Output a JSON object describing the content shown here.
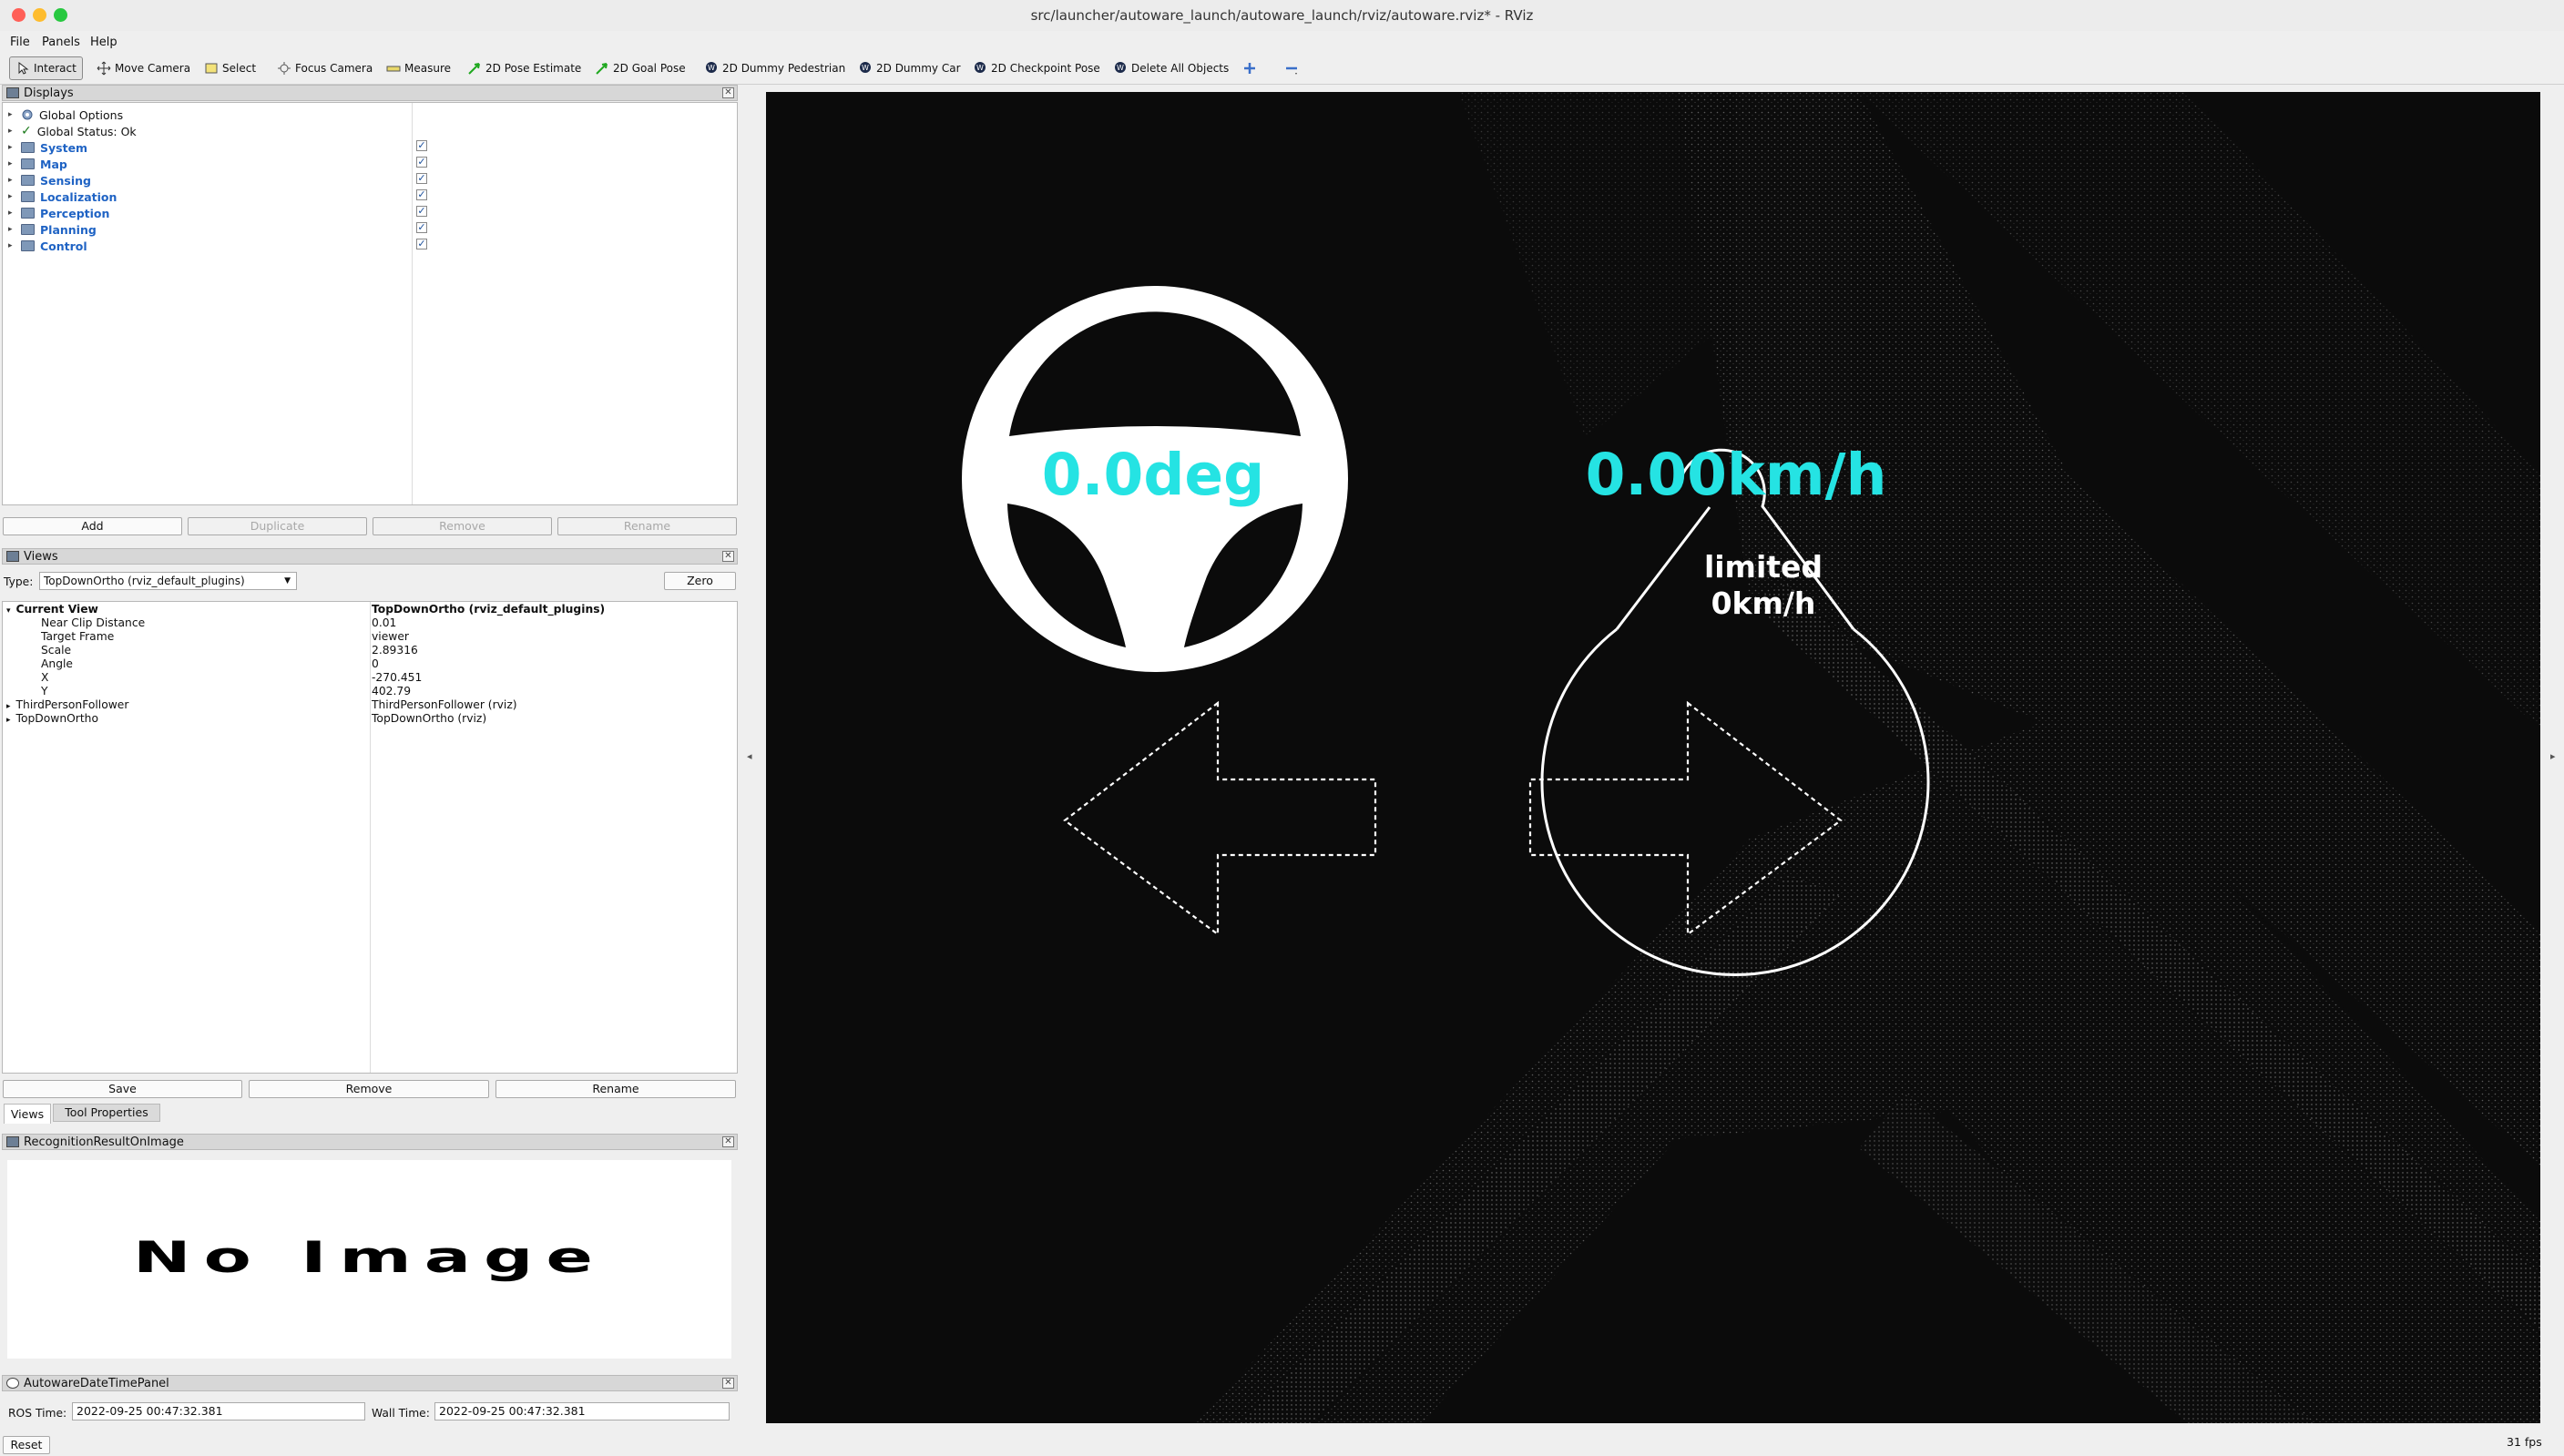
{
  "window": {
    "title": "src/launcher/autoware_launch/autoware_launch/rviz/autoware.rviz* - RViz",
    "traffic_lights": [
      "#ff5f57",
      "#febc2e",
      "#28c840"
    ]
  },
  "menu": [
    "File",
    "Panels",
    "Help"
  ],
  "toolbar": {
    "interact": "Interact",
    "move_camera": "Move Camera",
    "select": "Select",
    "focus_camera": "Focus Camera",
    "measure": "Measure",
    "pose_estimate": "2D Pose Estimate",
    "goal_pose": "2D Goal Pose",
    "dummy_pedestrian": "2D Dummy Pedestrian",
    "dummy_car": "2D Dummy Car",
    "checkpoint_pose": "2D Checkpoint Pose",
    "delete_all": "Delete All Objects"
  },
  "displays": {
    "header": "Displays",
    "global_options": "Global Options",
    "global_status": "Global Status: Ok",
    "groups": [
      "System",
      "Map",
      "Sensing",
      "Localization",
      "Perception",
      "Planning",
      "Control"
    ],
    "buttons": {
      "add": "Add",
      "duplicate": "Duplicate",
      "remove": "Remove",
      "rename": "Rename"
    }
  },
  "views": {
    "header": "Views",
    "type_label": "Type:",
    "type_value": "TopDownOrtho (rviz_default_plugins)",
    "zero": "Zero",
    "current_view": {
      "label": "Current View",
      "value": "TopDownOrtho (rviz_default_plugins)"
    },
    "props": [
      {
        "k": "Near Clip Distance",
        "v": "0.01"
      },
      {
        "k": "Target Frame",
        "v": "viewer"
      },
      {
        "k": "Scale",
        "v": "2.89316"
      },
      {
        "k": "Angle",
        "v": "0"
      },
      {
        "k": "X",
        "v": "-270.451"
      },
      {
        "k": "Y",
        "v": "402.79"
      }
    ],
    "saved": [
      {
        "k": "ThirdPersonFollower",
        "v": "ThirdPersonFollower (rviz)"
      },
      {
        "k": "TopDownOrtho",
        "v": "TopDownOrtho (rviz)"
      }
    ],
    "buttons": {
      "save": "Save",
      "remove": "Remove",
      "rename": "Rename"
    },
    "tabs": [
      "Views",
      "Tool Properties"
    ]
  },
  "recognition": {
    "header": "RecognitionResultOnImage",
    "no_image": "No Image"
  },
  "datetime": {
    "header": "AutowareDateTimePanel",
    "ros_label": "ROS Time:",
    "ros_value": "2022-09-25 00:47:32.381",
    "wall_label": "Wall Time:",
    "wall_value": "2022-09-25 00:47:32.381"
  },
  "reset": "Reset",
  "fps": "31 fps",
  "overlay": {
    "steering": "0.0deg",
    "speed": "0.00km/h",
    "limit_line1": "limited",
    "limit_line2": "0km/h",
    "accent": "#25e3e3"
  }
}
